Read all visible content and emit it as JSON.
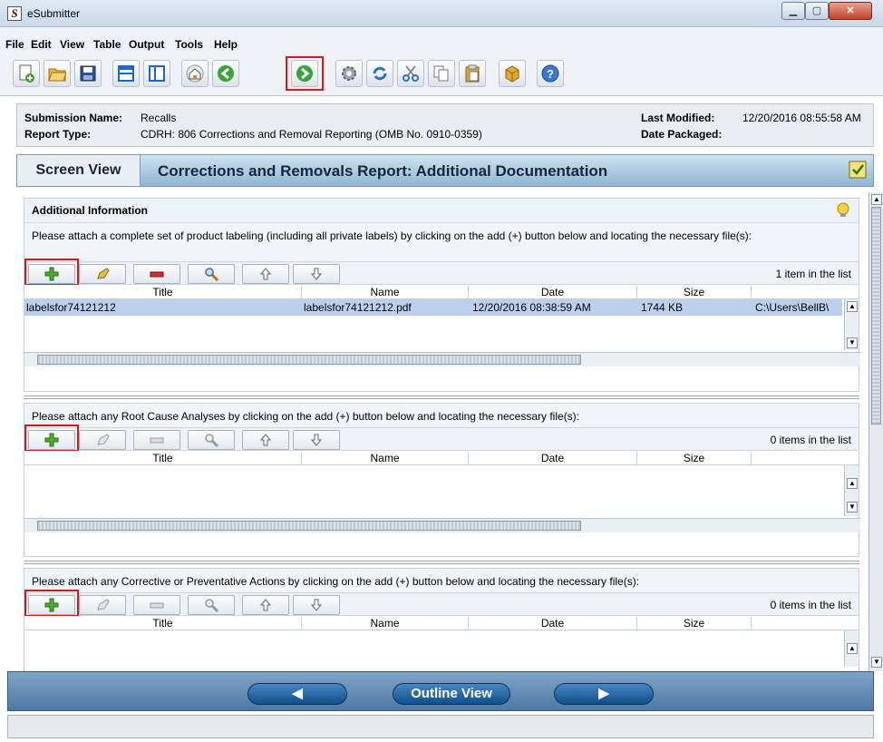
{
  "window": {
    "title": "eSubmitter",
    "app_icon_letter": "S"
  },
  "menu": [
    "File",
    "Edit",
    "View",
    "Table",
    "Output",
    "Tools",
    "Help"
  ],
  "toolbar_icons": [
    "new-document-icon",
    "open-folder-icon",
    "save-icon",
    "window-icon",
    "split-view-icon",
    "home-icon",
    "back-icon",
    "forward-icon",
    "settings-icon",
    "refresh-icon",
    "cut-icon",
    "copy-icon",
    "paste-icon",
    "package-icon",
    "help-icon"
  ],
  "header": {
    "submission_name_label": "Submission Name:",
    "submission_name": "Recalls",
    "report_type_label": "Report Type:",
    "report_type": "CDRH: 806 Corrections and Removal Reporting (OMB No. 0910-0359)",
    "last_modified_label": "Last Modified:",
    "last_modified": "12/20/2016 08:55:58 AM",
    "date_packaged_label": "Date Packaged:",
    "date_packaged": ""
  },
  "view": {
    "screen_view_label": "Screen View",
    "page_title": "Corrections and Removals Report: Additional Documentation"
  },
  "section1": {
    "heading": "Additional Information",
    "instruction": "Please attach a complete set of product labeling (including all private labels) by clicking on the add (+) button below and locating the necessary file(s):",
    "count": "1 item in the list",
    "columns": [
      "Title",
      "Name",
      "Date",
      "Size"
    ],
    "rows": [
      {
        "title": "labelsfor74121212",
        "name": "labelsfor74121212.pdf",
        "date": "12/20/2016 08:38:59 AM",
        "size": "1744 KB",
        "path": "C:\\Users\\BellB\\"
      }
    ]
  },
  "section2": {
    "instruction": "Please attach any Root Cause Analyses by clicking on the add (+) button below and locating the necessary file(s):",
    "count": "0 items in the list",
    "columns": [
      "Title",
      "Name",
      "Date",
      "Size"
    ]
  },
  "section3": {
    "instruction": "Please attach any Corrective or Preventative Actions by clicking on the add (+) button below and locating the necessary file(s):",
    "count": "0 items in the list",
    "columns": [
      "Title",
      "Name",
      "Date",
      "Size"
    ]
  },
  "nav": {
    "outline_view_label": "Outline View"
  },
  "colors": {
    "accent": "#0f4f8c",
    "highlight_box": "#c81e1e",
    "selected_row": "#bcd0ee"
  }
}
